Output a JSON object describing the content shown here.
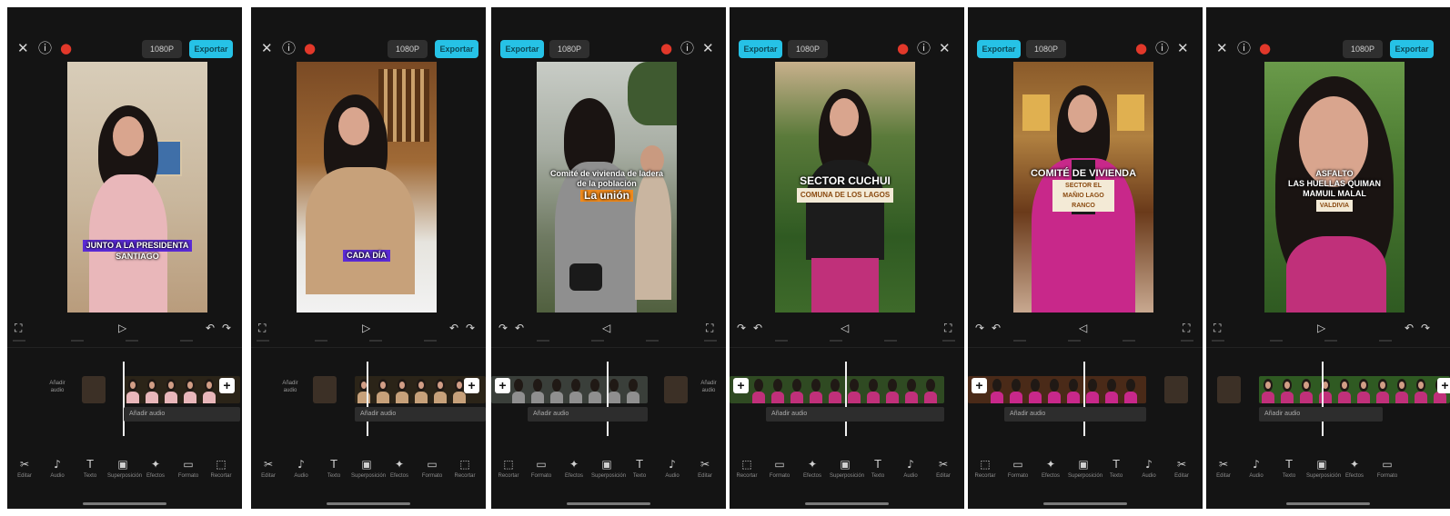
{
  "colors": {
    "panel_bg": "#141414",
    "export_accent": "#26c2e6",
    "drop_red": "#e2382a",
    "caption_purple": "#5b2bd6",
    "caption_orange": "#f08a1c",
    "caption_cream": "#f3ead6"
  },
  "icons": [
    "close-icon",
    "help-icon",
    "drop-icon",
    "play-icon",
    "undo-icon",
    "redo-icon",
    "fullscreen-icon",
    "plus-icon"
  ],
  "panels": [
    {
      "resolution": "1080P",
      "export": "Exportar",
      "caption_lines": [
        "JUNTO A LA PRESIDENTA",
        "SANTIAGO"
      ],
      "caption_highlight": "",
      "track_label": "Añadir audio",
      "cover_label": "Portada",
      "tools": [
        "Editar",
        "Audio",
        "Texto",
        "Superposición",
        "Efectos",
        "Formato",
        "Recortar"
      ]
    },
    {
      "resolution": "1080P",
      "export": "Exportar",
      "caption_lines": [],
      "caption_highlight": "CADA DÍA",
      "track_label": "Añadir audio",
      "cover_label": "Portada",
      "tools": [
        "Editar",
        "Audio",
        "Texto",
        "Superposición",
        "Efectos",
        "Formato",
        "Recortar"
      ]
    },
    {
      "resolution": "1080P",
      "export": "Exportar",
      "caption_lines": [
        "Comité de vivienda de ladera",
        "de la población"
      ],
      "caption_highlight": "La unión",
      "track_label": "Añadir audio",
      "cover_label": "Portada",
      "tools": [
        "Recortar",
        "Formato",
        "Efectos",
        "Superposición",
        "Texto",
        "Audio",
        "Editar"
      ]
    },
    {
      "resolution": "1080P",
      "export": "Exportar",
      "caption_lines": [
        "SECTOR CUCHUI"
      ],
      "caption_highlight": "COMUNA DE LOS LAGOS",
      "track_label": "Añadir audio",
      "cover_label": "Portada",
      "tools": [
        "Recortar",
        "Formato",
        "Efectos",
        "Superposición",
        "Texto",
        "Audio",
        "Editar"
      ]
    },
    {
      "resolution": "1080P",
      "export": "Exportar",
      "caption_lines": [
        "COMITÉ DE VIVIENDA"
      ],
      "caption_highlight": "SECTOR EL MAÑIO LAGO RANCO",
      "track_label": "Añadir audio",
      "cover_label": "Portada",
      "tools": [
        "Recortar",
        "Formato",
        "Efectos",
        "Superposición",
        "Texto",
        "Audio",
        "Editar"
      ]
    },
    {
      "resolution": "1080P",
      "export": "Exportar",
      "caption_lines": [
        "ASFALTO",
        "LAS HUELLAS QUIMAN",
        "MAMUIL MALAL"
      ],
      "caption_highlight": "VALDIVIA",
      "track_label": "Añadir audio",
      "cover_label": "Portada",
      "tools": [
        "Editar",
        "Audio",
        "Texto",
        "Superposición",
        "Efectos",
        "Formato"
      ]
    }
  ]
}
